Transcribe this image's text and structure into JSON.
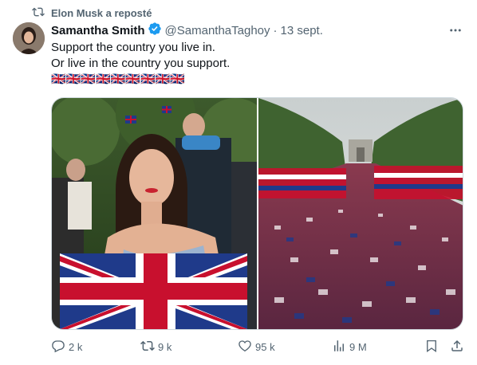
{
  "repost": {
    "label": "Elon Musk a reposté",
    "icon": "repost-icon"
  },
  "tweet": {
    "author_name": "Samantha Smith",
    "verified": true,
    "handle": "@SamanthaTaghoy",
    "separator": "·",
    "date": "13 sept.",
    "lines": [
      "Support the country you live in.",
      "Or live in the country you support.",
      "🇬🇧🇬🇧🇬🇧🇬🇧🇬🇧🇬🇧🇬🇧🇬🇧🇬🇧"
    ]
  },
  "media": {
    "left_image": "woman-with-union-jack-flag",
    "right_image": "crowd-with-union-jack-flags-on-the-mall"
  },
  "actions": {
    "replies": "2 k",
    "reposts": "9 k",
    "likes": "95 k",
    "views": "9 M"
  },
  "colors": {
    "text": "#0f1419",
    "muted": "#536471",
    "verified": "#1d9bf0",
    "border": "#cfd9de"
  }
}
